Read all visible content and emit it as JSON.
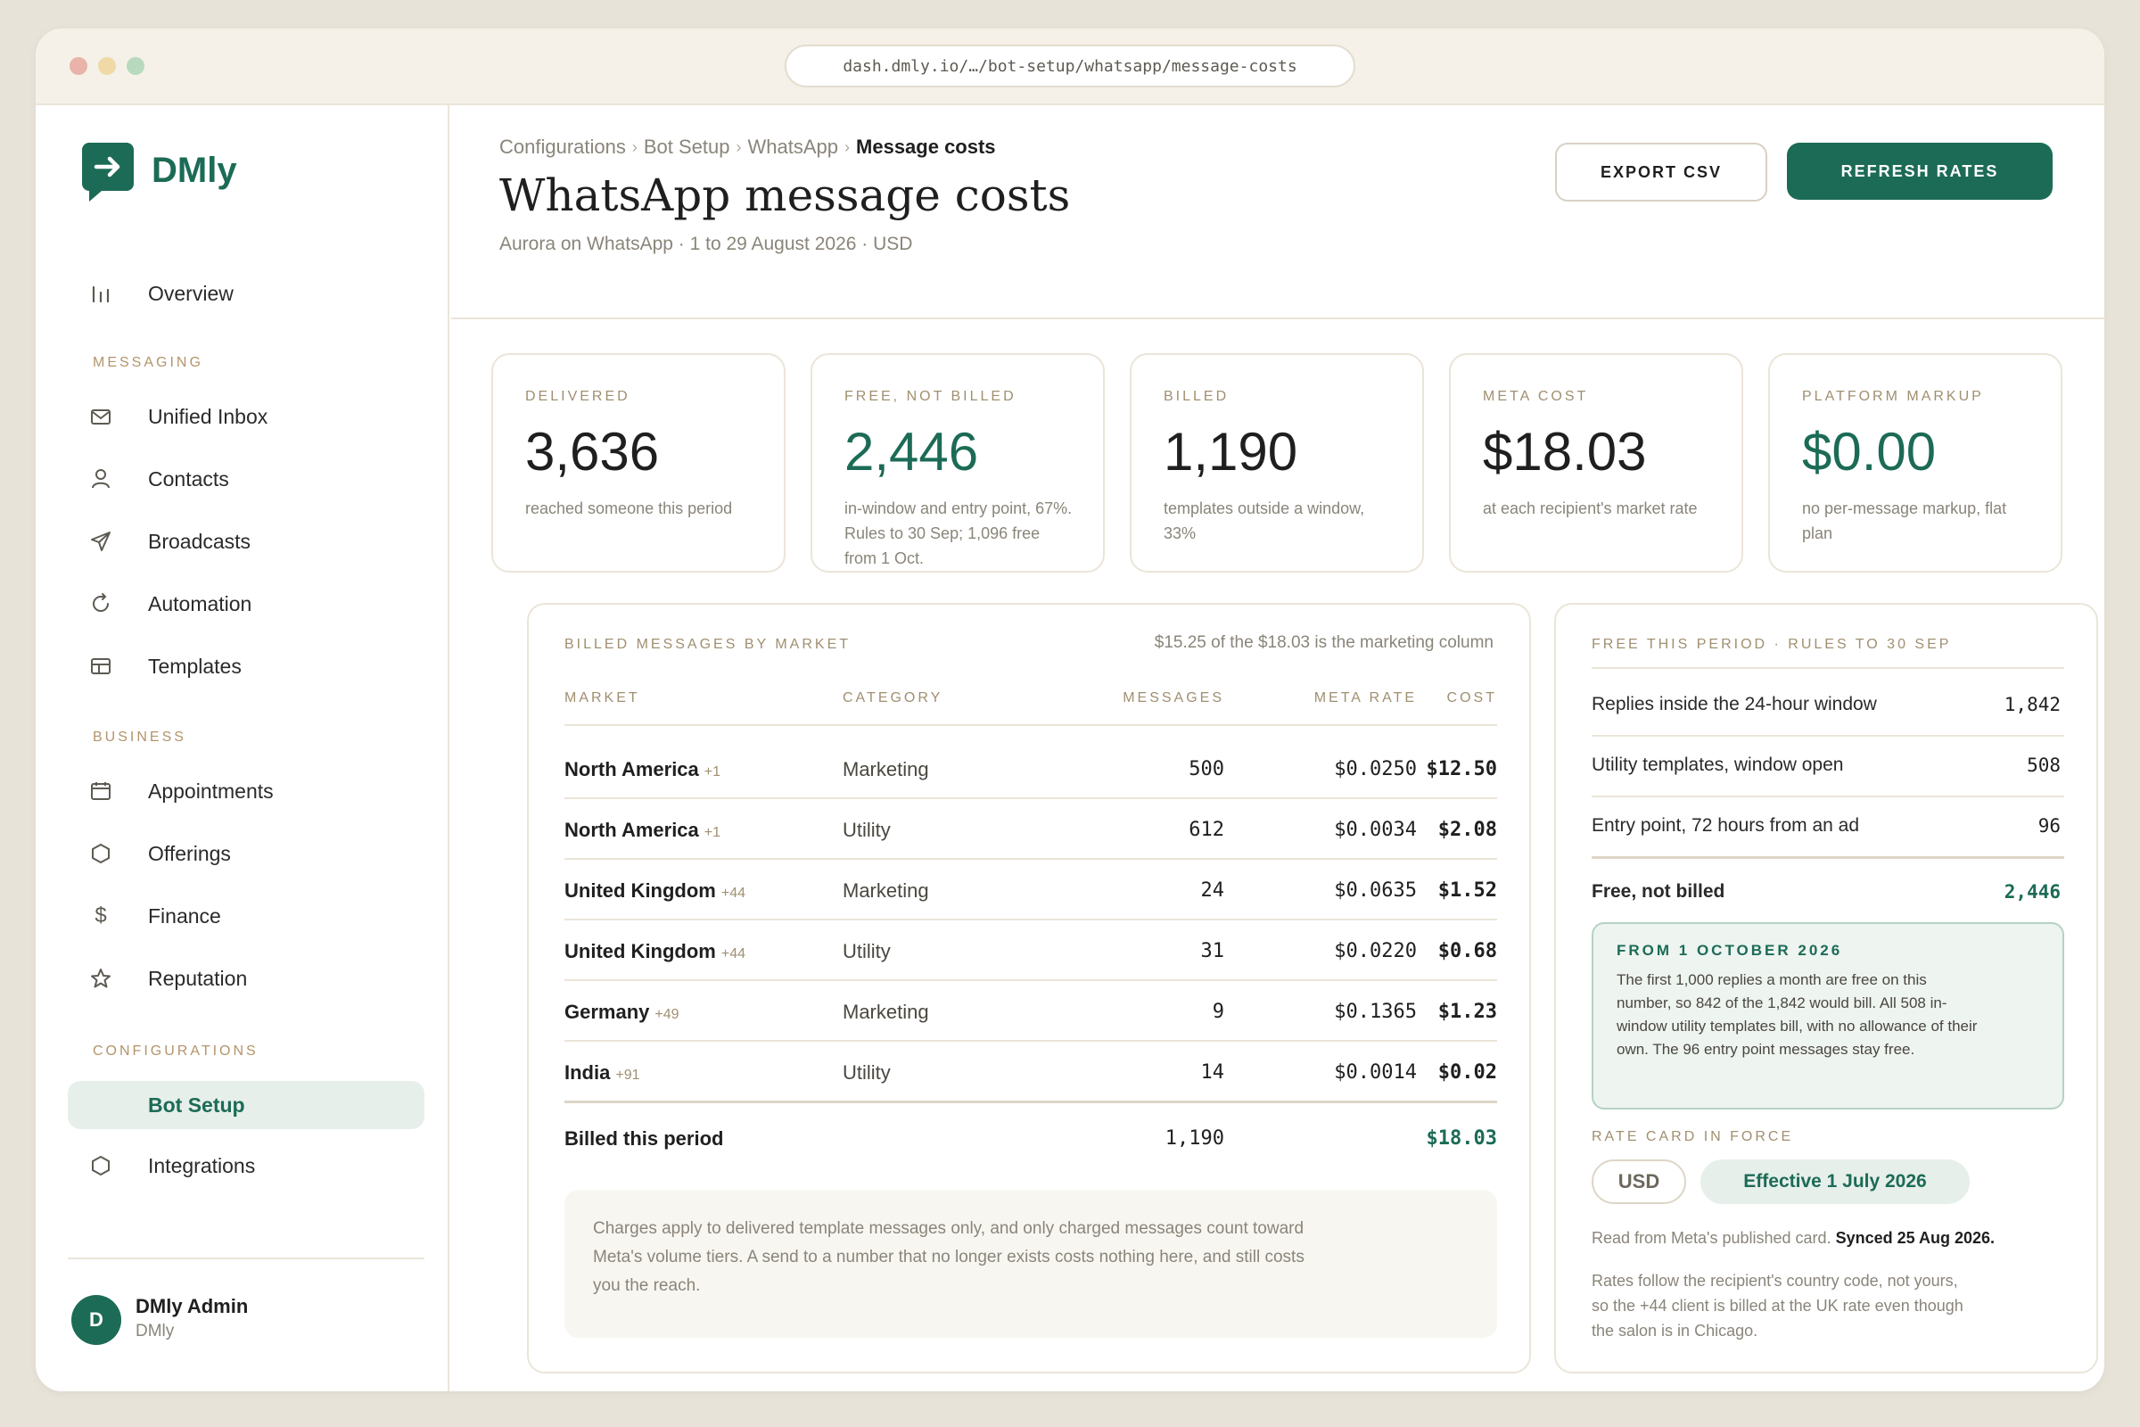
{
  "url": "dash.dmly.io/…/bot-setup/whatsapp/message-costs",
  "brand": {
    "name": "DMly"
  },
  "sidebar": {
    "overview": "Overview",
    "sections": {
      "messaging": "MESSAGING",
      "business": "BUSINESS",
      "configurations": "CONFIGURATIONS"
    },
    "items": {
      "inbox": "Unified Inbox",
      "contacts": "Contacts",
      "broadcasts": "Broadcasts",
      "automation": "Automation",
      "templates": "Templates",
      "appointments": "Appointments",
      "offerings": "Offerings",
      "finance": "Finance",
      "reputation": "Reputation",
      "bot_setup": "Bot Setup",
      "integrations": "Integrations"
    },
    "user": {
      "initial": "D",
      "name": "DMly Admin",
      "org": "DMly"
    }
  },
  "header": {
    "breadcrumbs": [
      "Configurations",
      "Bot Setup",
      "WhatsApp",
      "Message costs"
    ],
    "title": "WhatsApp message costs",
    "subtitle": "Aurora on WhatsApp · 1 to 29 August 2026 · USD",
    "export_label": "EXPORT CSV",
    "refresh_label": "REFRESH RATES"
  },
  "stats": [
    {
      "label": "DELIVERED",
      "value": "3,636",
      "desc": "reached someone this period"
    },
    {
      "label": "FREE, NOT BILLED",
      "value": "2,446",
      "desc": "in-window and entry point, 67%. Rules to 30 Sep; 1,096 free from 1 Oct."
    },
    {
      "label": "BILLED",
      "value": "1,190",
      "desc": "templates outside a window, 33%"
    },
    {
      "label": "META COST",
      "value": "$18.03",
      "desc": "at each recipient's market rate"
    },
    {
      "label": "PLATFORM MARKUP",
      "value": "$0.00",
      "desc": "no per-message markup, flat plan"
    }
  ],
  "billed": {
    "title": "BILLED MESSAGES BY MARKET",
    "note": "$15.25 of the $18.03 is the marketing column",
    "columns": {
      "market": "MARKET",
      "category": "CATEGORY",
      "messages": "MESSAGES",
      "rate": "META RATE",
      "cost": "COST"
    },
    "rows": [
      {
        "market": "North America",
        "code": "+1",
        "category": "Marketing",
        "messages": "500",
        "rate": "$0.0250",
        "cost": "$12.50"
      },
      {
        "market": "North America",
        "code": "+1",
        "category": "Utility",
        "messages": "612",
        "rate": "$0.0034",
        "cost": "$2.08"
      },
      {
        "market": "United Kingdom",
        "code": "+44",
        "category": "Marketing",
        "messages": "24",
        "rate": "$0.0635",
        "cost": "$1.52"
      },
      {
        "market": "United Kingdom",
        "code": "+44",
        "category": "Utility",
        "messages": "31",
        "rate": "$0.0220",
        "cost": "$0.68"
      },
      {
        "market": "Germany",
        "code": "+49",
        "category": "Marketing",
        "messages": "9",
        "rate": "$0.1365",
        "cost": "$1.23"
      },
      {
        "market": "India",
        "code": "+91",
        "category": "Utility",
        "messages": "14",
        "rate": "$0.0014",
        "cost": "$0.02"
      }
    ],
    "total": {
      "label": "Billed this period",
      "messages": "1,190",
      "cost": "$18.03"
    },
    "footnote": "Charges apply to delivered template messages only, and only charged messages count toward Meta's volume tiers. A send to a number that no longer exists costs nothing here, and still costs you the reach."
  },
  "free": {
    "title": "FREE THIS PERIOD · RULES TO 30 SEP",
    "rows": [
      {
        "label": "Replies inside the 24-hour window",
        "value": "1,842"
      },
      {
        "label": "Utility templates, window open",
        "value": "508"
      },
      {
        "label": "Entry point, 72 hours from an ad",
        "value": "96"
      }
    ],
    "total": {
      "label": "Free, not billed",
      "value": "2,446"
    },
    "callout_title": "FROM 1 OCTOBER 2026",
    "callout_body": "The first 1,000 replies a month are free on this number, so 842 of the 1,842 would bill. All 508 in-window utility templates bill, with no allowance of their own. The 96 entry point messages stay free.",
    "rate_title": "RATE CARD IN FORCE",
    "currency": "USD",
    "effective": "Effective 1 July 2026",
    "source": "Read from Meta's published card.",
    "synced": "Synced 25 Aug 2026.",
    "note": "Rates follow the recipient's country code, not yours, so the +44 client is billed at the UK rate even though the salon is in Chicago."
  },
  "colors": {
    "brand": "#1c6b56",
    "accent_muted": "#a08f70",
    "background": "#e8e3d8"
  }
}
